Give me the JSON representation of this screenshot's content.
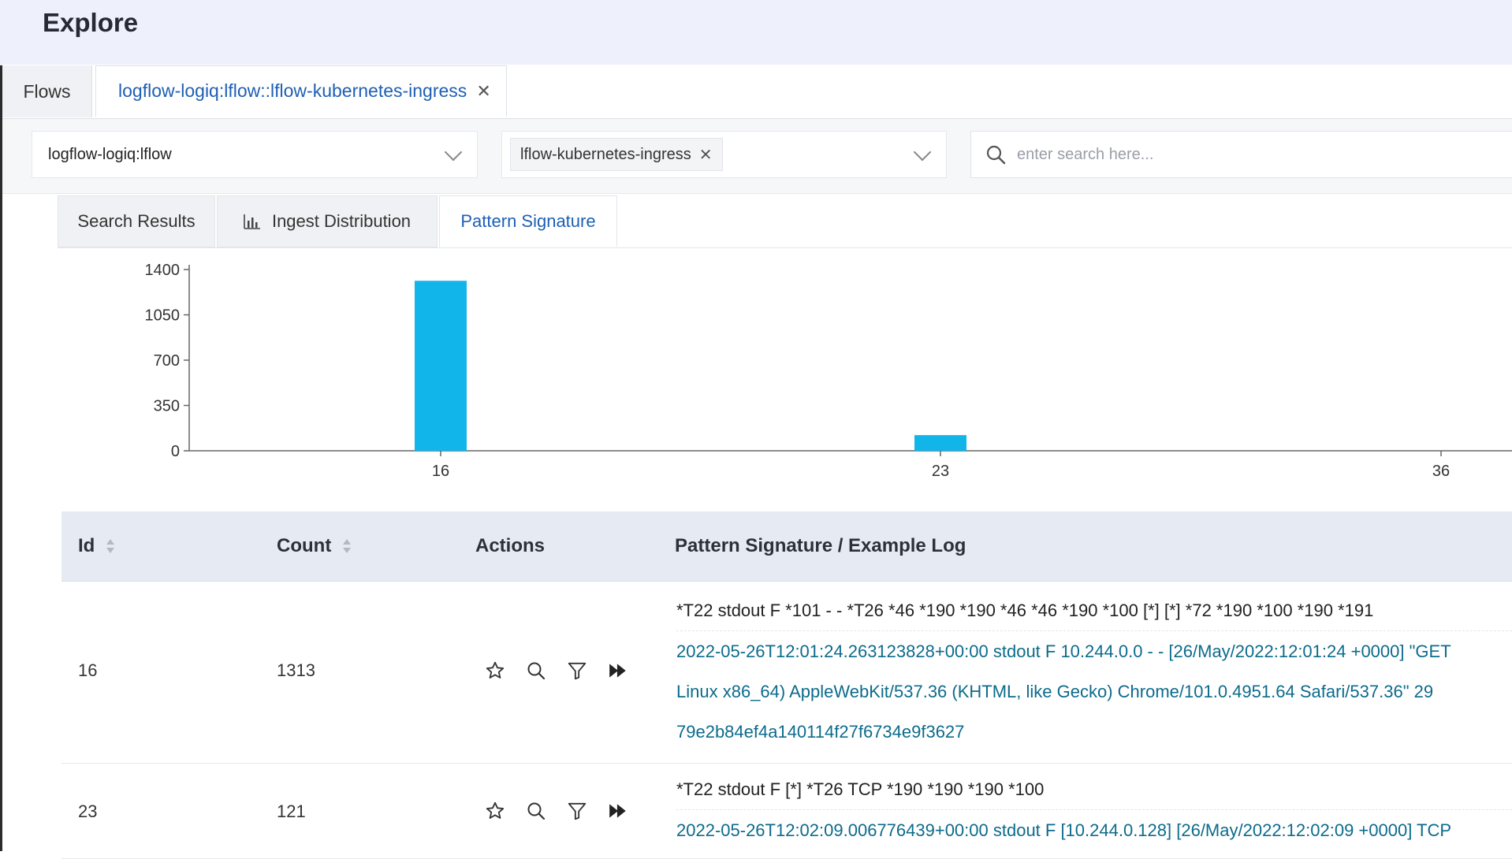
{
  "header": {
    "title": "Explore"
  },
  "top_tabs": {
    "flows_label": "Flows",
    "active_label": "logflow-logiq:lflow::lflow-kubernetes-ingress"
  },
  "filters": {
    "namespace_value": "logflow-logiq:lflow",
    "app_chip": "lflow-kubernetes-ingress",
    "search_placeholder": "enter search here..."
  },
  "sub_tabs": {
    "search_results": "Search Results",
    "ingest_distribution": "Ingest Distribution",
    "pattern_signature": "Pattern Signature"
  },
  "chart_data": {
    "type": "bar",
    "categories": [
      "16",
      "23",
      "36"
    ],
    "values": [
      1313,
      121,
      0
    ],
    "ylim": [
      0,
      1400
    ],
    "yticks": [
      0,
      350,
      700,
      1050,
      1400
    ],
    "title": "",
    "xlabel": "",
    "ylabel": "",
    "bar_color": "#12b5ea"
  },
  "table": {
    "headers": {
      "id": "Id",
      "count": "Count",
      "actions": "Actions",
      "pattern": "Pattern Signature / Example Log"
    },
    "rows": [
      {
        "id": "16",
        "count": "1313",
        "pattern": "*T22 stdout F *101 - - *T26 *46 *190 *190 *46 *46 *190 *100 [*] [*] *72 *190 *100 *190 *191",
        "log_lines": [
          "2022-05-26T12:01:24.263123828+00:00 stdout F 10.244.0.0 - - [26/May/2022:12:01:24 +0000] \"GET",
          "Linux x86_64) AppleWebKit/537.36 (KHTML, like Gecko) Chrome/101.0.4951.64 Safari/537.36\" 29",
          "79e2b84ef4a140114f27f6734e9f3627"
        ]
      },
      {
        "id": "23",
        "count": "121",
        "pattern": "*T22 stdout F [*] *T26 TCP *190 *190 *190 *100",
        "log_lines": [
          "2022-05-26T12:02:09.006776439+00:00 stdout F [10.244.0.128] [26/May/2022:12:02:09 +0000] TCP"
        ]
      }
    ]
  },
  "colors": {
    "accent": "#1e5fb4",
    "log_text": "#0c6b8c",
    "bar": "#12b5ea"
  },
  "icons": [
    "close-icon",
    "chevron-down-icon",
    "search-icon",
    "bar-chart-icon",
    "sort-icon",
    "star-icon",
    "magnify-icon",
    "filter-icon",
    "fast-forward-icon"
  ]
}
